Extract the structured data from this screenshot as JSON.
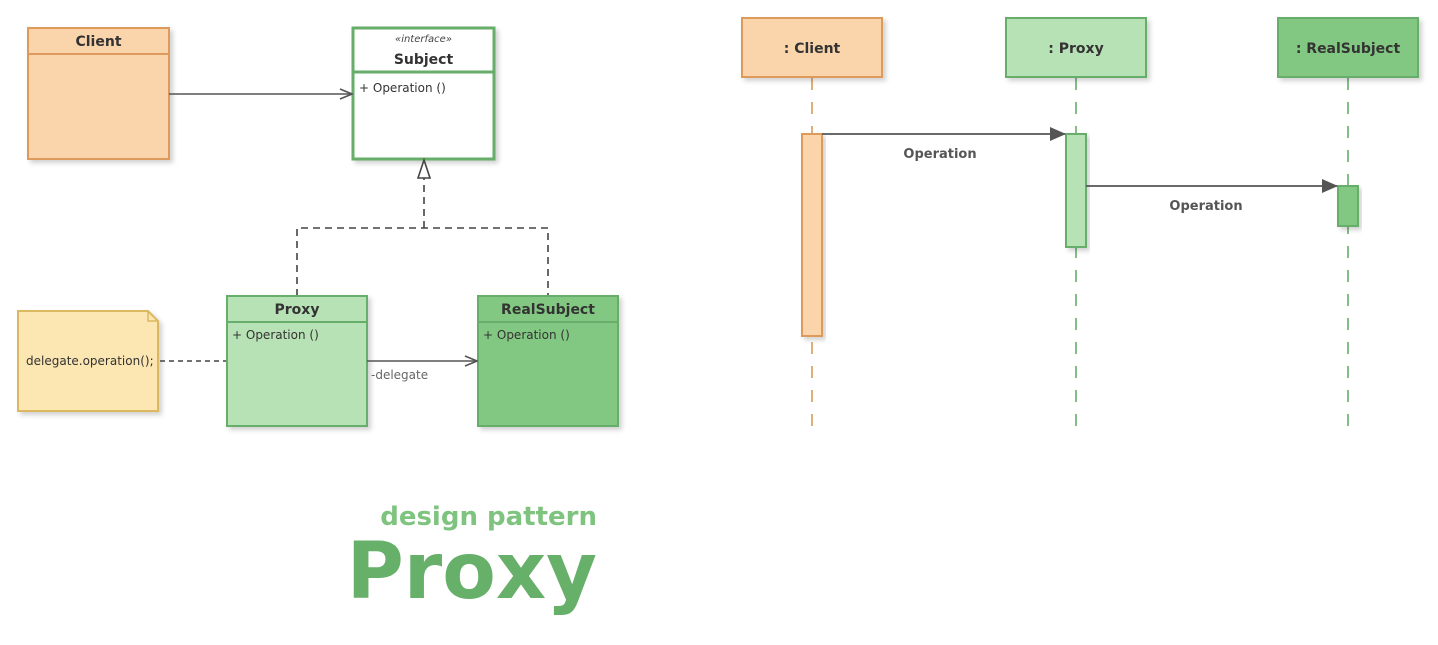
{
  "class_diagram": {
    "client": {
      "name": "Client"
    },
    "subject": {
      "stereotype": "«interface»",
      "name": "Subject",
      "members": [
        "+ Operation ()"
      ]
    },
    "proxy": {
      "name": "Proxy",
      "members": [
        "+ Operation ()"
      ]
    },
    "real_subject": {
      "name": "RealSubject",
      "members": [
        "+ Operation ()"
      ]
    },
    "note": {
      "text": "delegate.operation();"
    },
    "delegate_label": "-delegate"
  },
  "sequence_diagram": {
    "lifelines": [
      {
        "name": ": Client"
      },
      {
        "name": ": Proxy"
      },
      {
        "name": ": RealSubject"
      }
    ],
    "messages": [
      {
        "from": ": Client",
        "to": ": Proxy",
        "label": "Operation"
      },
      {
        "from": ": Proxy",
        "to": ": RealSubject",
        "label": "Operation"
      }
    ]
  },
  "caption": {
    "subtitle": "design pattern",
    "title": "Proxy"
  },
  "colors": {
    "orange_fill": "#fad4aa",
    "orange_stroke": "#dd9a5a",
    "light_green_fill": "#b7e2b5",
    "mid_green_fill": "#82c882",
    "green_stroke": "#66ae69",
    "note_fill": "#fce7b2",
    "note_stroke": "#dcb860",
    "edge": "#555555"
  }
}
